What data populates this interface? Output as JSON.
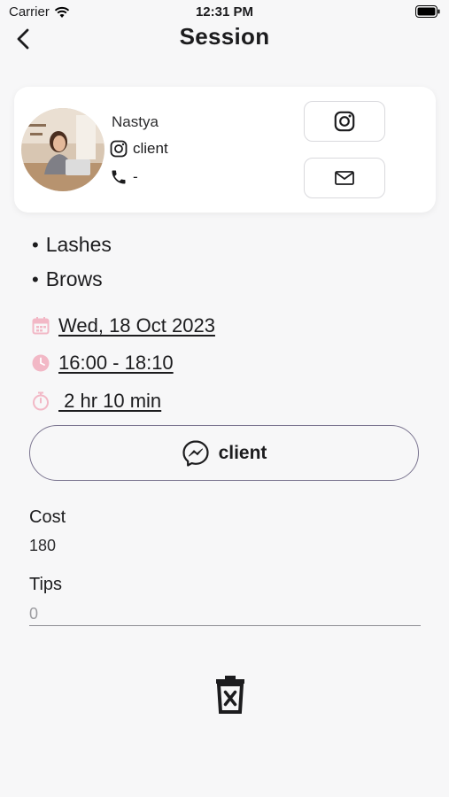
{
  "status_bar": {
    "carrier": "Carrier",
    "time": "12:31 PM"
  },
  "nav": {
    "title": "Session"
  },
  "client": {
    "name": "Nastya",
    "instagram": "client",
    "phone": "-"
  },
  "services": [
    "Lashes",
    "Brows"
  ],
  "session": {
    "date": "Wed, 18 Oct 2023",
    "time_range": "16:00 - 18:10",
    "duration": " 2 hr 10 min"
  },
  "chat_button": {
    "label": "client"
  },
  "cost": {
    "label": "Cost",
    "value": "180"
  },
  "tips": {
    "label": "Tips",
    "placeholder": "0"
  },
  "colors": {
    "accent_pink": "#f2b8c6",
    "outline": "#7b7590"
  },
  "icons": [
    "wifi-icon",
    "battery-icon",
    "back-icon",
    "instagram-icon",
    "phone-icon",
    "mail-icon",
    "calendar-icon",
    "clock-icon",
    "stopwatch-icon",
    "messenger-icon",
    "trash-icon"
  ]
}
